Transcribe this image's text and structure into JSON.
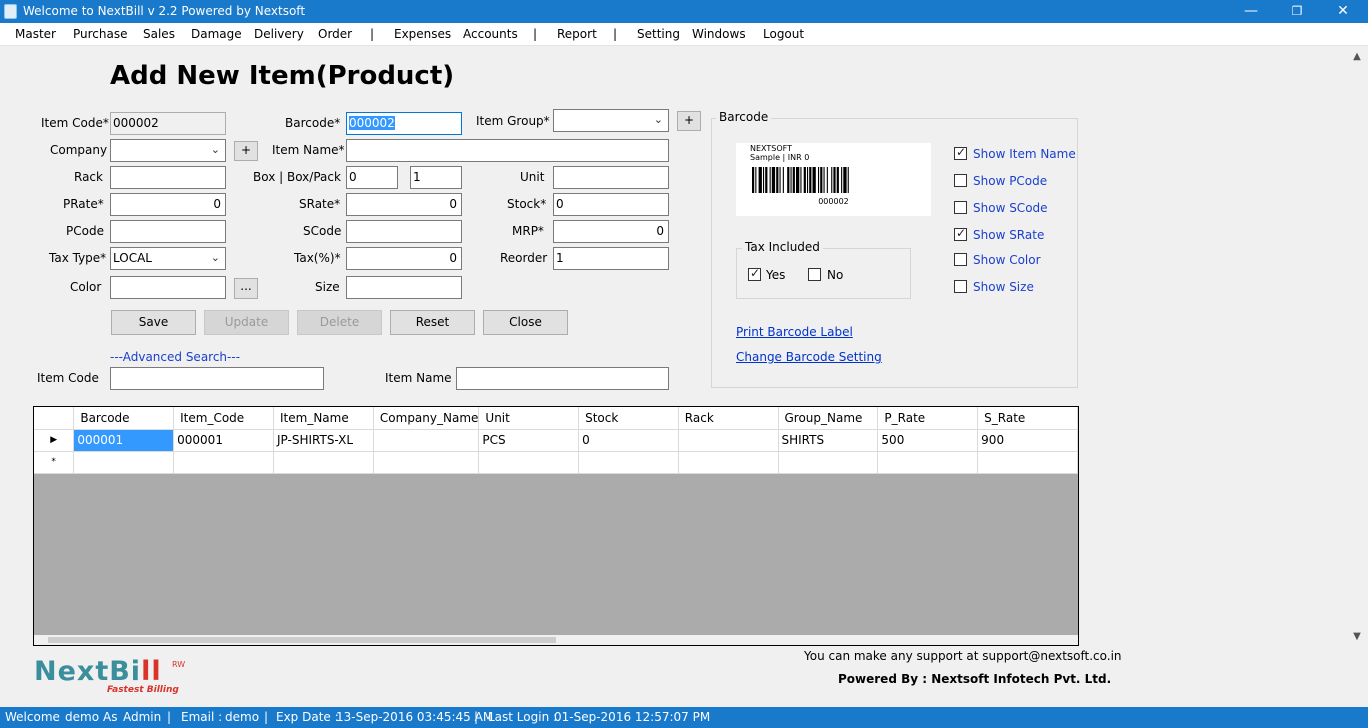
{
  "window": {
    "title": "Welcome to NextBill v 2.2 Powered by Nextsoft",
    "minimize": "—",
    "restore": "❐",
    "close": "✕"
  },
  "menu": [
    "Master",
    "Purchase",
    "Sales",
    "Damage",
    "Delivery",
    "Order",
    "|",
    "Expenses",
    "Accounts",
    "|",
    "Report",
    "|",
    "Setting",
    "Windows",
    "Logout"
  ],
  "form": {
    "heading": "Add New Item(Product)",
    "item_code": {
      "label": "Item Code*",
      "value": "000002"
    },
    "barcode": {
      "label": "Barcode*",
      "value": "000002"
    },
    "item_group": {
      "label": "Item Group*",
      "value": ""
    },
    "company": {
      "label": "Company",
      "value": ""
    },
    "item_name": {
      "label": "Item Name*",
      "value": ""
    },
    "rack": {
      "label": "Rack",
      "value": ""
    },
    "box_pack": {
      "label": "Box | Box/Pack",
      "box": "0",
      "pack": "1"
    },
    "unit": {
      "label": "Unit",
      "value": ""
    },
    "prate": {
      "label": "PRate*",
      "value": "0"
    },
    "srate": {
      "label": "SRate*",
      "value": "0"
    },
    "stock": {
      "label": "Stock*",
      "value": "0"
    },
    "pcode": {
      "label": "PCode",
      "value": ""
    },
    "scode": {
      "label": "SCode",
      "value": ""
    },
    "mrp": {
      "label": "MRP*",
      "value": "0"
    },
    "tax_type": {
      "label": "Tax Type*",
      "value": "LOCAL"
    },
    "tax_pct": {
      "label": "Tax(%)*",
      "value": "0"
    },
    "reorder": {
      "label": "Reorder",
      "value": "1"
    },
    "color": {
      "label": "Color",
      "value": ""
    },
    "size": {
      "label": "Size",
      "value": ""
    },
    "plus": "+",
    "ellipsis": "...",
    "buttons": {
      "save": "Save",
      "update": "Update",
      "delete": "Delete",
      "reset": "Reset",
      "close": "Close"
    },
    "advanced_search": "---Advanced Search---",
    "search_item_code": {
      "label": "Item Code",
      "value": ""
    },
    "search_item_name": {
      "label": "Item Name",
      "value": ""
    }
  },
  "barcode_panel": {
    "title": "Barcode",
    "preview": {
      "company": "NEXTSOFT",
      "line2": "Sample | INR 0",
      "code": "000002"
    },
    "tax_included": {
      "title": "Tax Included",
      "yes": "Yes",
      "no": "No",
      "yes_checked": true,
      "no_checked": false
    },
    "options": [
      {
        "label": "Show Item Name",
        "checked": true
      },
      {
        "label": "Show PCode",
        "checked": false
      },
      {
        "label": "Show SCode",
        "checked": false
      },
      {
        "label": "Show SRate",
        "checked": true
      },
      {
        "label": "Show Color",
        "checked": false
      },
      {
        "label": "Show Size",
        "checked": false
      }
    ],
    "print_link": "Print Barcode Label",
    "settings_link": "Change Barcode Setting"
  },
  "grid": {
    "columns": [
      "Barcode",
      "Item_Code",
      "Item_Name",
      "Company_Name",
      "Unit",
      "Stock",
      "Rack",
      "Group_Name",
      "P_Rate",
      "S_Rate"
    ],
    "rows": [
      {
        "marker": "▶",
        "cells": [
          "000001",
          "000001",
          "JP-SHIRTS-XL",
          "",
          "PCS",
          "0",
          "",
          "SHIRTS",
          "500",
          "900"
        ]
      }
    ],
    "new_row_marker": "*"
  },
  "footer": {
    "logo_main": "NextBi",
    "logo_accent": "ll",
    "logo_sub": "Fastest Billing",
    "logo_rw": "RW",
    "support": "You can make any support at support@nextsoft.co.in",
    "powered": "Powered By : Nextsoft Infotech Pvt. Ltd."
  },
  "status": {
    "welcome": "Welcome",
    "user": "demo",
    "as": "As",
    "role": "Admin",
    "email_label": "Email :",
    "email": "demo",
    "exp_label": "Exp Date :",
    "exp": "13-Sep-2016 03:45:45 AM",
    "last_label": "Last Login :",
    "last": "01-Sep-2016 12:57:07 PM",
    "sep": "|"
  },
  "colors": {
    "titlebar": "#1979ca",
    "statusbar": "#1979ca",
    "link": "#0033cc",
    "selection": "#3399ff",
    "logo_teal": "#3b8f9c",
    "logo_red": "#d9342b"
  }
}
